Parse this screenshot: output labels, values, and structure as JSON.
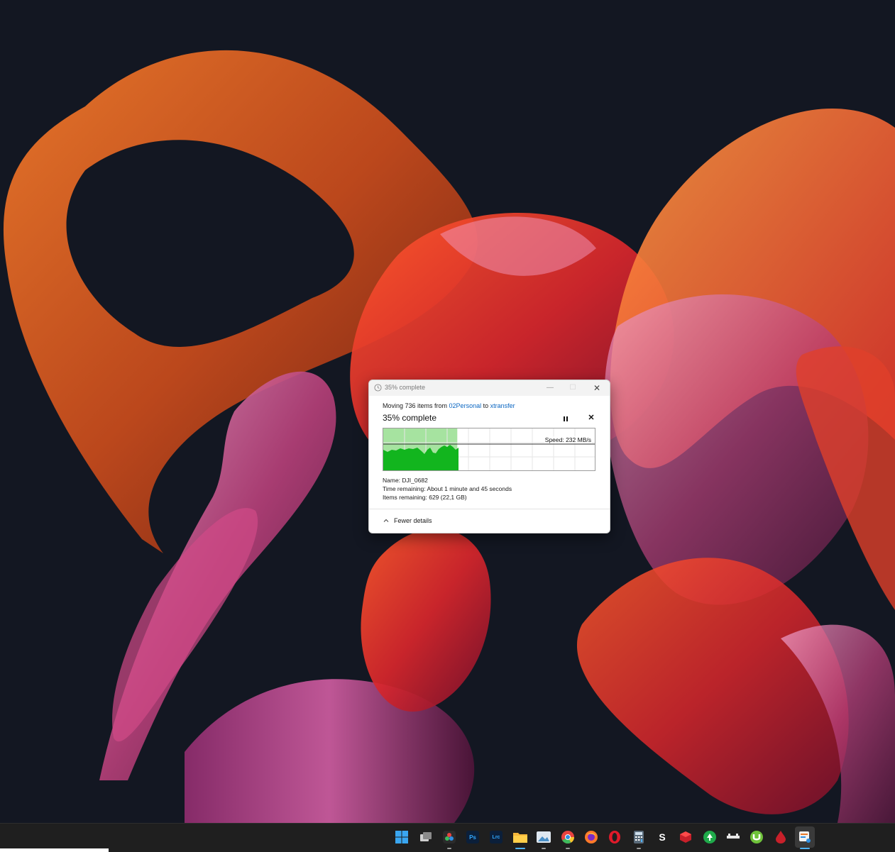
{
  "window": {
    "title": "35% complete",
    "minimize_label": "—",
    "maximize_label": "☐",
    "close_label": "✕"
  },
  "operation": {
    "prefix": "Moving 736 items from ",
    "source": "02Personal",
    "connector": " to ",
    "destination": "xtransfer",
    "heading": "35% complete",
    "progress": 0.35,
    "speed_label": "Speed: 232 MB/s",
    "cancel_label": "✕"
  },
  "details": {
    "name_label": "Name:",
    "name_value": "DJI_0682",
    "time_label": "Time remaining:",
    "time_value": "About 1 minute and 45 seconds",
    "items_label": "Items remaining:",
    "items_value": "629 (22,1 GB)"
  },
  "footer": {
    "toggle_label": "Fewer details"
  },
  "colors": {
    "progress_fill": "#a6e3a0",
    "speed_fill": "#12b51e",
    "link": "#0a66c2",
    "taskbar": "#1f1f1f",
    "accent": "#4fb3ff"
  },
  "taskbar": {
    "ps_label": "Ps",
    "lrc_label": "Lrc",
    "s_label": "S",
    "icons": [
      "windows-start-icon",
      "task-view-icon",
      "davinci-resolve-icon",
      "photoshop-icon",
      "lightroom-classic-icon",
      "file-explorer-icon",
      "photos-icon",
      "chrome-icon",
      "firefox-icon",
      "opera-icon",
      "calculator-icon",
      "s-app-icon",
      "3d-app-icon",
      "green-app-icon",
      "dji-icon",
      "utorrent-icon",
      "red-drop-icon",
      "active-app-icon"
    ]
  }
}
